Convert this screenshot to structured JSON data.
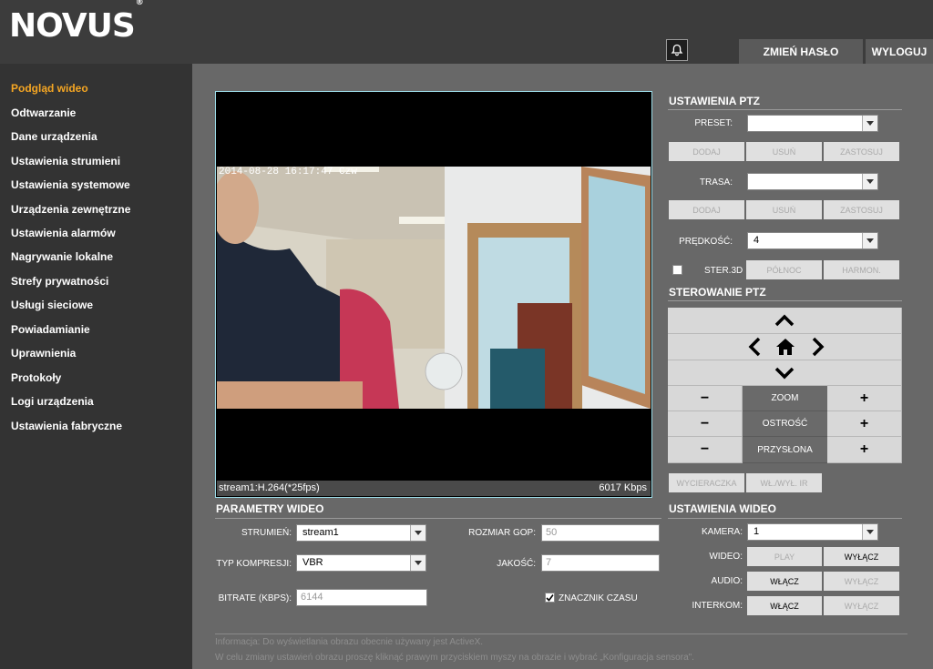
{
  "header": {
    "logo": "NOVUS",
    "logo_mark": "®",
    "change_password": "ZMIEŃ HASŁO",
    "logout": "WYLOGUJ"
  },
  "sidebar": {
    "items": [
      {
        "label": "Podgląd wideo",
        "active": true
      },
      {
        "label": "Odtwarzanie"
      },
      {
        "label": "Dane urządzenia"
      },
      {
        "label": "Ustawienia strumieni"
      },
      {
        "label": "Ustawienia systemowe"
      },
      {
        "label": "Urządzenia zewnętrzne"
      },
      {
        "label": "Ustawienia alarmów"
      },
      {
        "label": "Nagrywanie lokalne"
      },
      {
        "label": "Strefy prywatności"
      },
      {
        "label": "Usługi sieciowe"
      },
      {
        "label": "Powiadamianie"
      },
      {
        "label": "Uprawnienia"
      },
      {
        "label": "Protokoły"
      },
      {
        "label": "Logi urządzenia"
      },
      {
        "label": "Ustawienia fabryczne"
      }
    ]
  },
  "video": {
    "timestamp": "2014-08-28 16:17:47 Czw",
    "stream_info": "stream1:H.264(*25fps)",
    "bitrate": "6017 Kbps"
  },
  "video_params": {
    "title": "PARAMETRY WIDEO",
    "stream_label": "STRUMIEŃ:",
    "stream_value": "stream1",
    "compression_label": "TYP KOMPRESJI:",
    "compression_value": "VBR",
    "bitrate_label": "BITRATE (KBPS):",
    "bitrate_value": "6144",
    "gop_label": "ROZMIAR GOP:",
    "gop_value": "50",
    "quality_label": "JAKOŚĆ:",
    "quality_value": "7",
    "timestamp_label": "ZNACZNIK CZASU",
    "timestamp_checked": true
  },
  "ptz_settings": {
    "title": "USTAWIENIA PTZ",
    "preset_label": "PRESET:",
    "preset_value": "",
    "route_label": "TRASA:",
    "route_value": "",
    "speed_label": "PRĘDKOŚĆ:",
    "speed_value": "4",
    "add": "DODAJ",
    "remove": "USUŃ",
    "apply": "ZASTOSUJ",
    "ster3d": "STER.3D",
    "north": "PÓŁNOC",
    "harmon": "HARMON."
  },
  "ptz_control": {
    "title": "STEROWANIE PTZ",
    "zoom": "ZOOM",
    "focus": "OSTROŚĆ",
    "iris": "PRZYSŁONA",
    "minus": "−",
    "plus": "+",
    "wiper": "WYCIERACZKA",
    "ir": "WŁ./WYŁ. IR"
  },
  "video_settings": {
    "title": "USTAWIENIA WIDEO",
    "camera_label": "KAMERA:",
    "camera_value": "1",
    "video_label": "WIDEO:",
    "play": "PLAY",
    "off": "WYŁĄCZ",
    "audio_label": "AUDIO:",
    "on": "WŁĄCZ",
    "intercom_label": "INTERKOM:"
  },
  "info": {
    "line1": "Informacja: Do wyświetlania obrazu obecnie używany jest ActiveX.",
    "line2": "W celu zmiany ustawień obrazu proszę kliknąć prawym przyciskiem myszy na obrazie i wybrać „Konfiguracja sensora\"."
  },
  "colors": {
    "accent": "#f5a623",
    "sidebar": "#333333",
    "main": "#686868",
    "frame": "#9cdce8"
  }
}
